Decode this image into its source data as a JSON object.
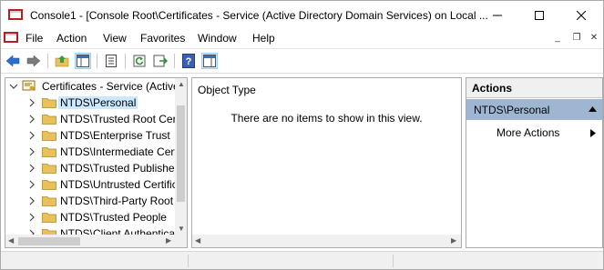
{
  "window": {
    "title": "Console1 - [Console Root\\Certificates - Service (Active Directory Domain Services) on Local ...",
    "minimize_glyph": "─",
    "maximize_glyph": "☐",
    "close_glyph": "✕"
  },
  "menu": {
    "items": [
      "File",
      "Action",
      "View",
      "Favorites",
      "Window",
      "Help"
    ],
    "mdi": {
      "minimize": "_",
      "restore": "❐",
      "close": "✕"
    }
  },
  "toolbar": {
    "buttons": [
      "back-arrow-icon",
      "forward-arrow-icon",
      "up-folder-icon",
      "show-hide-tree-icon",
      "properties-icon",
      "refresh-icon",
      "export-list-icon",
      "help-icon",
      "show-hide-action-pane-icon"
    ]
  },
  "tree": {
    "root_label": "Certificates - Service (Active Directory Domain Services)",
    "items": [
      "NTDS\\Personal",
      "NTDS\\Trusted Root Certification Authorities",
      "NTDS\\Enterprise Trust",
      "NTDS\\Intermediate Certification Authorities",
      "NTDS\\Trusted Publishers",
      "NTDS\\Untrusted Certificates",
      "NTDS\\Third-Party Root Certification Authorities",
      "NTDS\\Trusted People",
      "NTDS\\Client Authentication Issuers"
    ],
    "selected_index": 0
  },
  "list": {
    "column_header": "Object Type",
    "empty_message": "There are no items to show in this view."
  },
  "actions": {
    "header": "Actions",
    "section": "NTDS\\Personal",
    "more_actions": "More Actions"
  },
  "colors": {
    "selection": "#cce8ff",
    "actions_section_bg": "#9fb6d2",
    "folder": "#e8c15a"
  }
}
